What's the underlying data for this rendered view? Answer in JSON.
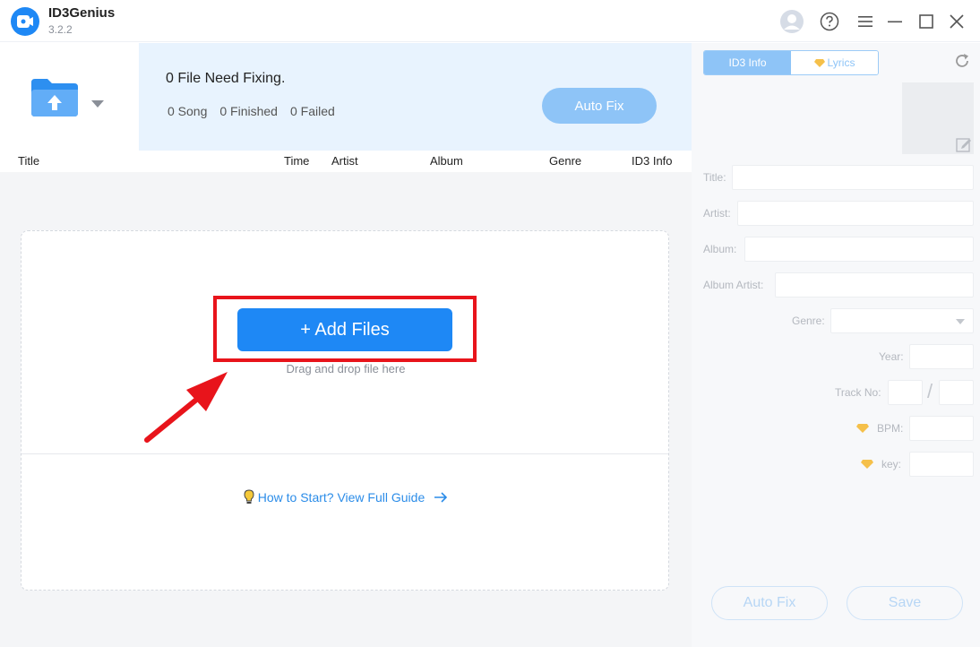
{
  "app": {
    "name": "ID3Genius",
    "version": "3.2.2"
  },
  "summary": {
    "title": "0 File Need Fixing.",
    "song": "0 Song",
    "finished": "0 Finished",
    "failed": "0 Failed",
    "auto_fix_label": "Auto Fix"
  },
  "table": {
    "columns": [
      "Title",
      "Time",
      "Artist",
      "Album",
      "Genre",
      "ID3 Info"
    ]
  },
  "dropzone": {
    "add_files_label": "+ Add Files",
    "hint": "Drag and drop file here",
    "guide_link": "How to Start? View Full Guide"
  },
  "right_panel": {
    "tabs": [
      "ID3 Info",
      "Lyrics"
    ],
    "fields": {
      "title": "Title:",
      "artist": "Artist:",
      "album": "Album:",
      "album_artist": "Album Artist:",
      "genre": "Genre:",
      "year": "Year:",
      "track_no": "Track No:",
      "track_sep": "/",
      "bpm": "BPM:",
      "key": "key:"
    },
    "auto_fix_label": "Auto Fix",
    "save_label": "Save"
  },
  "colors": {
    "accent": "#1e88f5",
    "highlight": "#e8141b",
    "premium": "#f5c04a"
  }
}
